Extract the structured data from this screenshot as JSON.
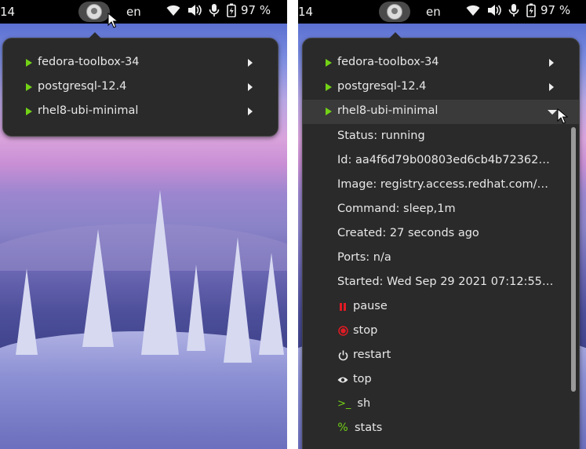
{
  "left": {
    "topbar": {
      "clock": "14",
      "language": "en",
      "battery_percent": "97 %"
    },
    "containers": [
      {
        "name": "fedora-toolbox-34",
        "state": "running"
      },
      {
        "name": "postgresql-12.4",
        "state": "running"
      },
      {
        "name": "rhel8-ubi-minimal",
        "state": "running"
      }
    ]
  },
  "right": {
    "topbar": {
      "clock": "14",
      "language": "en",
      "battery_percent": "97 %"
    },
    "containers": [
      {
        "name": "fedora-toolbox-34",
        "state": "running"
      },
      {
        "name": "postgresql-12.4",
        "state": "running"
      },
      {
        "name": "rhel8-ubi-minimal",
        "state": "running",
        "expanded": true
      }
    ],
    "details": [
      "Status: running",
      "Id: aa4f6d79b00803ed6cb4b723620c…",
      "Image: registry.access.redhat.com/ubi…",
      "Command: sleep,1m",
      "Created: 27 seconds ago",
      "Ports: n/a",
      "Started: Wed Sep 29 2021 07:12:55 GM…"
    ],
    "actions": [
      {
        "label": "pause",
        "icon": "pause-icon",
        "color": "#e01b24"
      },
      {
        "label": "stop",
        "icon": "stop-icon",
        "color": "#e01b24"
      },
      {
        "label": "restart",
        "icon": "power-icon",
        "color": "#e8e8e8"
      },
      {
        "label": "top",
        "icon": "eye-icon",
        "color": "#e8e8e8"
      },
      {
        "label": "sh",
        "icon": "terminal-icon",
        "color": "#73d216",
        "glyph": ">_"
      },
      {
        "label": "stats",
        "icon": "percent-icon",
        "color": "#73d216",
        "glyph": "%"
      }
    ]
  },
  "colors": {
    "running": "#73d216",
    "panel_bg": "#2a2a2a",
    "topbar_bg": "#000000"
  }
}
